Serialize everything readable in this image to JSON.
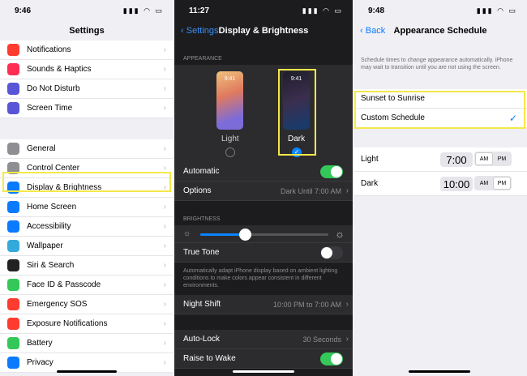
{
  "panel1": {
    "time": "9:46",
    "title": "Settings",
    "group1": [
      {
        "label": "Notifications",
        "icon": "notifications-icon",
        "color": "#ff3b30"
      },
      {
        "label": "Sounds & Haptics",
        "icon": "speaker-icon",
        "color": "#ff2d55"
      },
      {
        "label": "Do Not Disturb",
        "icon": "moon-icon",
        "color": "#5856d6"
      },
      {
        "label": "Screen Time",
        "icon": "hourglass-icon",
        "color": "#5856d6"
      }
    ],
    "group2": [
      {
        "label": "General",
        "icon": "gear-icon",
        "color": "#8e8e93"
      },
      {
        "label": "Control Center",
        "icon": "switches-icon",
        "color": "#8e8e93"
      },
      {
        "label": "Display & Brightness",
        "icon": "aa-icon",
        "color": "#0a7aff"
      },
      {
        "label": "Home Screen",
        "icon": "grid-icon",
        "color": "#0a7aff"
      },
      {
        "label": "Accessibility",
        "icon": "accessibility-icon",
        "color": "#0a7aff"
      },
      {
        "label": "Wallpaper",
        "icon": "flower-icon",
        "color": "#34aadc"
      },
      {
        "label": "Siri & Search",
        "icon": "siri-icon",
        "color": "#222222"
      },
      {
        "label": "Face ID & Passcode",
        "icon": "faceid-icon",
        "color": "#34c759"
      },
      {
        "label": "Emergency SOS",
        "icon": "sos-icon",
        "color": "#ff3b30"
      },
      {
        "label": "Exposure Notifications",
        "icon": "exposure-icon",
        "color": "#ff3b30"
      },
      {
        "label": "Battery",
        "icon": "battery-icon",
        "color": "#34c759"
      },
      {
        "label": "Privacy",
        "icon": "hand-icon",
        "color": "#0a7aff"
      }
    ]
  },
  "panel2": {
    "time": "11:27",
    "back": "Settings",
    "title": "Display & Brightness",
    "appearance_header": "APPEARANCE",
    "light_label": "Light",
    "dark_label": "Dark",
    "light_time": "9:41",
    "dark_time": "9:41",
    "automatic_label": "Automatic",
    "options_label": "Options",
    "options_value": "Dark Until 7:00 AM",
    "brightness_header": "BRIGHTNESS",
    "brightness_level": 0.35,
    "true_tone_label": "True Tone",
    "true_tone_desc": "Automatically adapt iPhone display based on ambient lighting conditions to make colors appear consistent in different environments.",
    "night_shift_label": "Night Shift",
    "night_shift_value": "10:00 PM to 7:00 AM",
    "auto_lock_label": "Auto-Lock",
    "auto_lock_value": "30 Seconds",
    "raise_label": "Raise to Wake"
  },
  "panel3": {
    "time": "9:48",
    "back": "Back",
    "title": "Appearance Schedule",
    "desc": "Schedule times to change appearance automatically. iPhone may wait to transition until you are not using the screen.",
    "sunset_label": "Sunset to Sunrise",
    "custom_label": "Custom Schedule",
    "light_label": "Light",
    "light_time": "7:00",
    "dark_label": "Dark",
    "dark_time": "10:00",
    "am": "AM",
    "pm": "PM"
  }
}
